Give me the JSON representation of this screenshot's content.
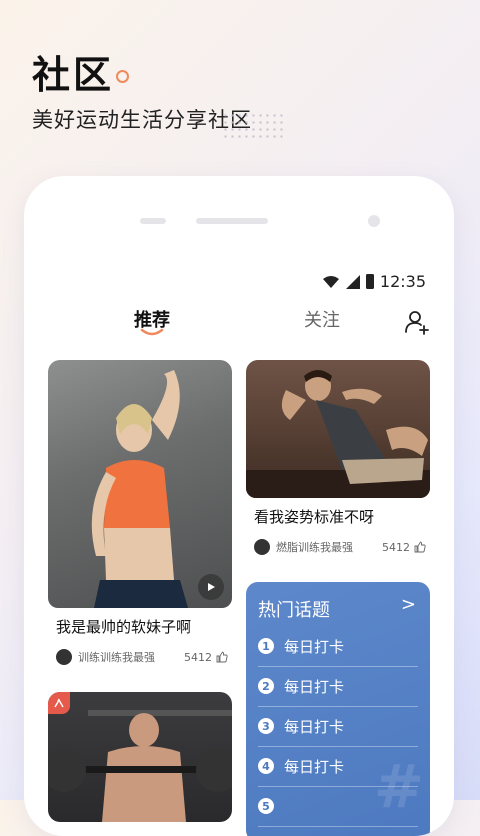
{
  "promo": {
    "title": "社区",
    "subtitle": "美好运动生活分享社区"
  },
  "status_bar": {
    "time": "12:35"
  },
  "tabs": [
    {
      "label": "推荐",
      "active": true
    },
    {
      "label": "关注",
      "active": false
    }
  ],
  "posts": [
    {
      "title": "我是最帅的软妹子啊",
      "author": "训练训练我最强",
      "likes": "5412",
      "is_video": true
    },
    {
      "title": "看我姿势标准不呀",
      "author": "燃脂训练我最强",
      "likes": "5412",
      "is_video": false
    },
    {
      "title": "",
      "author": "",
      "likes": "",
      "is_video": false
    }
  ],
  "hot_topics": {
    "header": "热门话题",
    "more_glyph": ">",
    "items": [
      {
        "rank": "1",
        "label": "每日打卡"
      },
      {
        "rank": "2",
        "label": "每日打卡"
      },
      {
        "rank": "3",
        "label": "每日打卡"
      },
      {
        "rank": "4",
        "label": "每日打卡"
      },
      {
        "rank": "5",
        "label": ""
      }
    ]
  },
  "colors": {
    "accent_orange": "#f08a5d",
    "topics_blue": "#4d79c0",
    "badge_red": "#e55a4a"
  },
  "icons": [
    "wifi-icon",
    "signal-icon",
    "battery-icon",
    "add-user-icon",
    "play-icon",
    "like-icon",
    "badge-icon"
  ]
}
